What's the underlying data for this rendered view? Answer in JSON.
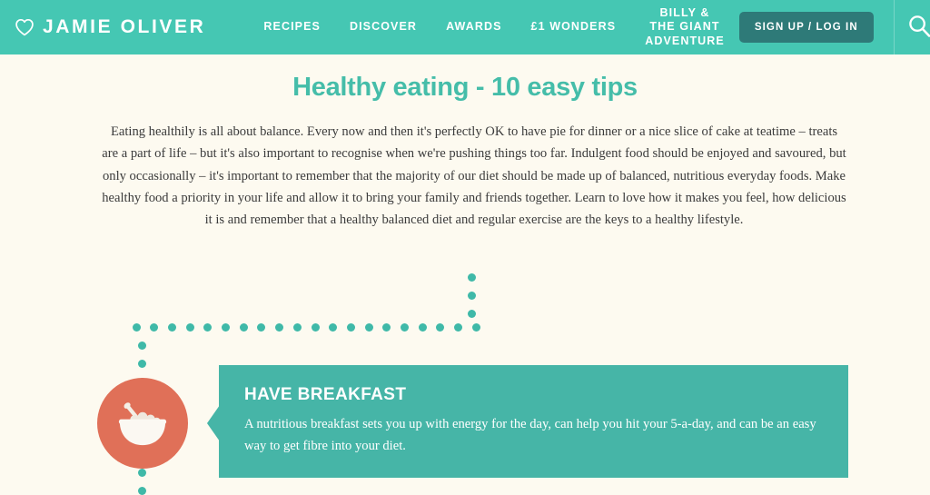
{
  "header": {
    "brand": {
      "icon": "heart-outline-icon",
      "wordmark": "JAMIE OLIVER"
    },
    "nav_items": [
      {
        "label": "RECIPES",
        "name": "nav-item-recipes",
        "two_line": false
      },
      {
        "label": "DISCOVER",
        "name": "nav-item-discover",
        "two_line": false
      },
      {
        "label": "AWARDS",
        "name": "nav-item-awards",
        "two_line": false
      },
      {
        "label": "£1 WONDERS",
        "name": "nav-item-one-pound-wonders",
        "two_line": false
      },
      {
        "label": "BILLY & THE GIANT ADVENTURE",
        "name": "nav-item-billy-and-the-giant-adventure",
        "two_line": true
      }
    ],
    "signup_label": "SIGN UP / LOG IN",
    "search_icon": "search-icon",
    "colors": {
      "header_background": "#45c7b3",
      "signup_background": "#2e7a78",
      "text": "#ffffff"
    }
  },
  "main": {
    "title": "Healthy eating - 10 easy tips",
    "intro": "Eating healthily is all about balance. Every now and then it's perfectly OK to have pie for dinner or a nice slice of cake at teatime – treats are a part of life – but it's also important to recognise when we're pushing things too far. Indulgent food should be enjoyed and savoured, but only occasionally – it's important to remember that the majority of our diet should be made up of balanced, nutritious everyday foods. Make healthy food a priority in your life and allow it to bring your family and friends together. Learn to love how it makes you feel, how delicious it is and remember that a healthy balanced diet and regular exercise are the keys to a healthy lifestyle.",
    "tip": {
      "title": "HAVE BREAKFAST",
      "body": "A nutritious breakfast sets you up with energy for the day, can help you hit your 5-a-day, and can be an easy way to get fibre into your diet.",
      "icon": "cereal-bowl-icon",
      "icon_badge_color": "#e07058",
      "card_color": "#46b5a7"
    }
  },
  "decoration": {
    "dot_color": "#3fb9a8",
    "dot_size": 9,
    "page_background": "#fdfaf0",
    "title_color": "#45bda9"
  }
}
